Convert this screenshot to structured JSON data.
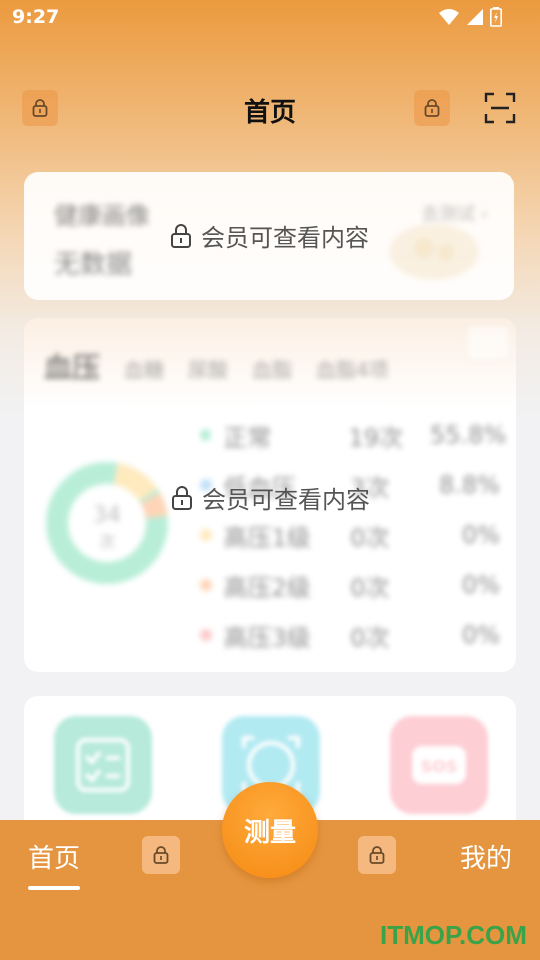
{
  "status_bar": {
    "time": "9:27"
  },
  "header": {
    "title": "首页"
  },
  "locked_text": "会员可查看内容",
  "health_card": {
    "title": "健康画像",
    "subtitle": "无数据",
    "pill": "去测试 ›"
  },
  "bp_card": {
    "tabs": [
      "血压",
      "血糖",
      "尿酸",
      "血脂",
      "血脂4项"
    ],
    "total_value": "34",
    "total_unit": "次",
    "legend": [
      {
        "name": "正常",
        "count": "19次",
        "pct": "55.8%",
        "color": "#7fe0b8"
      },
      {
        "name": "低血压",
        "count": "3次",
        "pct": "8.8%",
        "color": "#8fc8f4"
      },
      {
        "name": "高压1级",
        "count": "0次",
        "pct": "0%",
        "color": "#ffd98a"
      },
      {
        "name": "高压2级",
        "count": "0次",
        "pct": "0%",
        "color": "#ffb27d"
      },
      {
        "name": "高压3级",
        "count": "0次",
        "pct": "0%",
        "color": "#f7a0a0"
      }
    ]
  },
  "features": [
    {
      "icon": "checklist-icon",
      "color": "#9fe3cf"
    },
    {
      "icon": "scan-face-icon",
      "color": "#99e3ee"
    },
    {
      "icon": "sos-icon",
      "color": "#fdbec6"
    }
  ],
  "bottom_nav": {
    "home": "首页",
    "measure": "测量",
    "mine": "我的"
  },
  "watermark": "ITMOP.COM"
}
